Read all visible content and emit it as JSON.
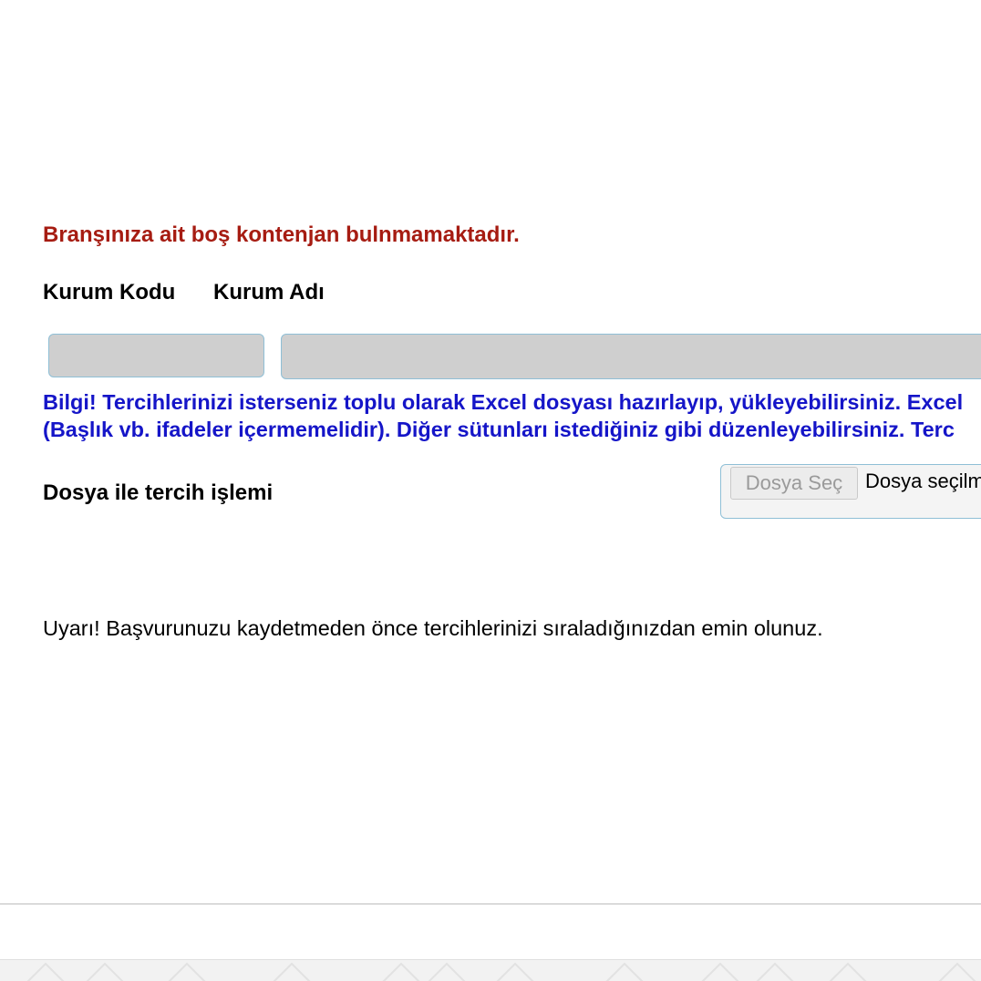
{
  "messages": {
    "no_quota_error": "Branşınıza ait boş kontenjan bulnmamaktadır.",
    "info_line_1": "Bilgi! Tercihlerinizi isterseniz toplu olarak Excel dosyası hazırlayıp, yükleyebilirsiniz. Excel",
    "info_line_2": "(Başlık vb. ifadeler içermemelidir). Diğer sütunları istediğiniz gibi düzenleyebilirsiniz. Terc",
    "warning": "Uyarı! Başvurunuzu kaydetmeden önce tercihlerinizi sıraladığınızdan emin olunuz."
  },
  "table": {
    "columns": [
      "Kurum Kodu",
      "Kurum Adı"
    ],
    "kurum_kodu_value": "",
    "kurum_adi_value": ""
  },
  "file_upload": {
    "label": "Dosya ile tercih işlemi",
    "button_label": "Dosya Seç",
    "status_text": "Dosya seçilm"
  },
  "colors": {
    "error": "#a61c12",
    "info": "#1515c8",
    "field_border": "#8fbfd6",
    "field_bg": "#cfcfcf"
  }
}
